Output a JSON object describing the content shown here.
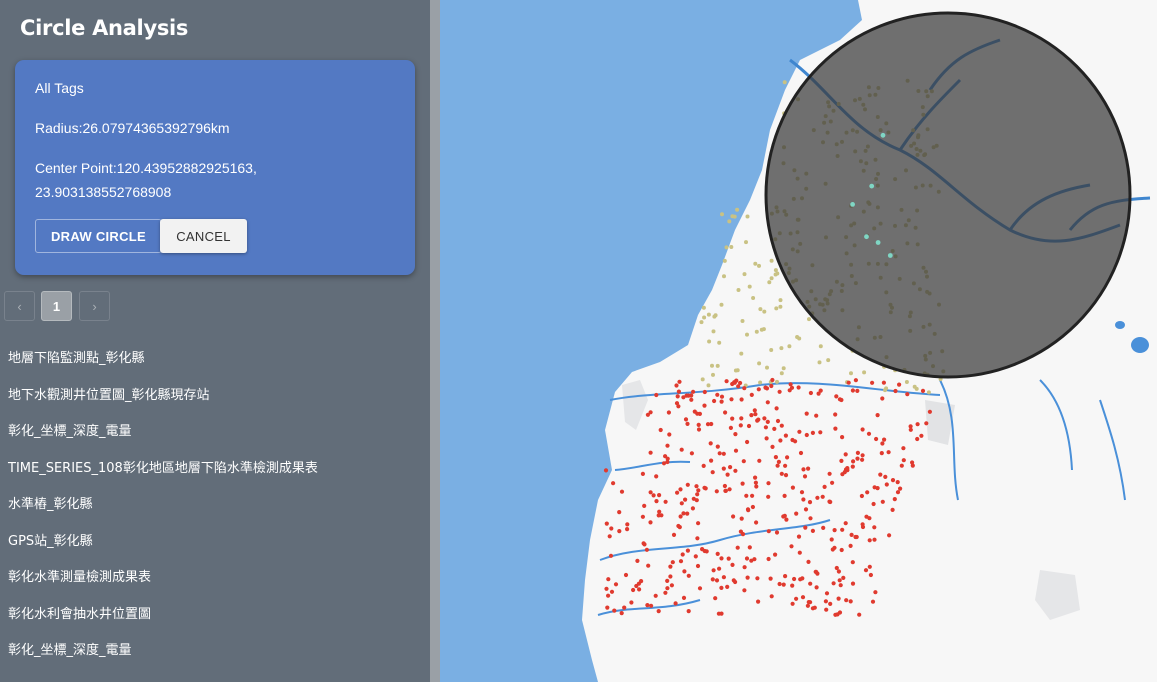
{
  "panel": {
    "title": "Circle Analysis",
    "tags_label": "All Tags",
    "radius_text": "Radius:26.07974365392796km",
    "center_line1": "Center Point:120.43952882925163,",
    "center_line2": "23.903138552768908",
    "draw_button": "DRAW CIRCLE",
    "cancel_button": "CANCEL"
  },
  "pagination": {
    "prev": "‹",
    "current": "1",
    "next": "›"
  },
  "layers": [
    "地層下陷監測點_彰化縣",
    "地下水觀測井位置圖_彰化縣現存站",
    "彰化_坐標_深度_電量",
    "TIME_SERIES_108彰化地區地層下陷水準檢測成果表",
    "水準樁_彰化縣",
    "GPS站_彰化縣",
    "彰化水準測量檢測成果表",
    "彰化水利會抽水井位置圖",
    "彰化_坐標_深度_電量"
  ],
  "colors": {
    "sea": "#7aafe3",
    "land": "#f7f7f7",
    "river": "#4a90d9",
    "circle_fill": "#3a3a3a",
    "points_north": "#c9c284",
    "points_south": "#e03a2f",
    "points_special": "#7fd6c4",
    "card": "#5379c3"
  }
}
